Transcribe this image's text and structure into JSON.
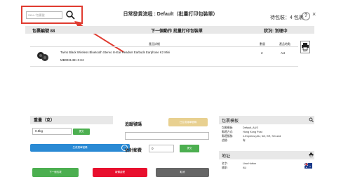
{
  "topbar": {
    "search_placeholder": "SKU / 包裹號",
    "title": "日常發貨流程 : Default（批量打印包裝單）",
    "pending": "待包裝：4 包裹",
    "help_label": "?",
    "close_label": "×"
  },
  "header": {
    "package_no": "包裹編號 88",
    "next_action": "下一個動作 批量打印包裝單",
    "status": "狀況: 划理中"
  },
  "table": {
    "headers": [
      "產品詳細",
      "數量",
      "產品地點"
    ],
    "rows": [
      {
        "name": "Twins Black Wireless Bluetooth Stereo In-Ear Headset Earbuds Earphone K2 Mini",
        "sku": "MB0031-BK-0-K2",
        "qty": "2",
        "location": "AU"
      }
    ],
    "print_label": "已列"
  },
  "weight": {
    "title": "重量（克）",
    "value": "0.5kg",
    "submit_label": "提交",
    "generate_label": "生成運單號碼",
    "generate_icon": "→"
  },
  "tracking": {
    "title": "追蹤號碼",
    "button_label": "已生成運單號碼",
    "input_value": "",
    "postage_title": "估計郵費",
    "postage_value": "0",
    "postage_submit": "提交"
  },
  "actions": {
    "next_label": "下一個包裹",
    "flag_label": "報備處理",
    "cancel_label": "取消"
  },
  "template": {
    "title": "包裹模板",
    "fields": [
      {
        "k": "包裹模板:",
        "v": "Default_AUS"
      },
      {
        "k": "郵遞方式:",
        "v": "Hong Kong Post"
      },
      {
        "k": "郵遞服務:",
        "v": "e-Express (AU, NZ, KR, SG and"
      },
      {
        "k": "追蹤:",
        "v": "有"
      }
    ]
  },
  "address": {
    "title": "地址",
    "fields": [
      {
        "k": "名字:",
        "v": "Lisa Hutton"
      },
      {
        "k": "國家:",
        "v": "AU"
      }
    ]
  },
  "colors": {
    "highlight": "#e03b30",
    "green": "#4caf50",
    "blue": "#2a8ad4",
    "red": "#e8102e",
    "gray": "#666666"
  }
}
